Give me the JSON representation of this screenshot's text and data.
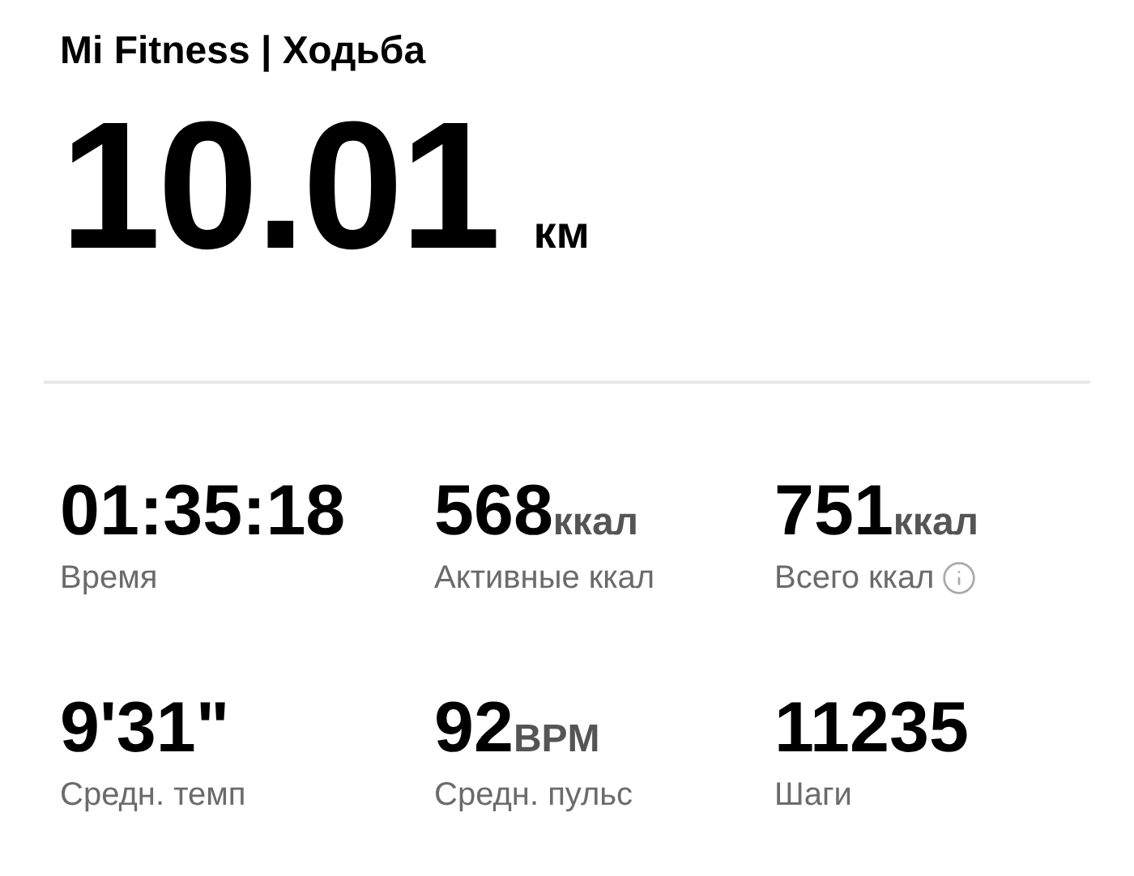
{
  "header": {
    "title": "Mi Fitness | Ходьба"
  },
  "distance": {
    "value": "10.01",
    "unit": "км"
  },
  "stats": [
    {
      "value": "01:35:18",
      "label": "Время",
      "info": false
    },
    {
      "value": "568",
      "unit": "ккал",
      "label": "Активные ккал",
      "info": false
    },
    {
      "value": "751",
      "unit": "ккал",
      "label": "Всего ккал",
      "info": true
    },
    {
      "value": "9'31\"",
      "label": "Средн. темп",
      "info": false
    },
    {
      "value": "92",
      "unit": "BPM",
      "label": "Средн. пульс",
      "info": false
    },
    {
      "value": "11235",
      "label": "Шаги",
      "info": false
    }
  ]
}
